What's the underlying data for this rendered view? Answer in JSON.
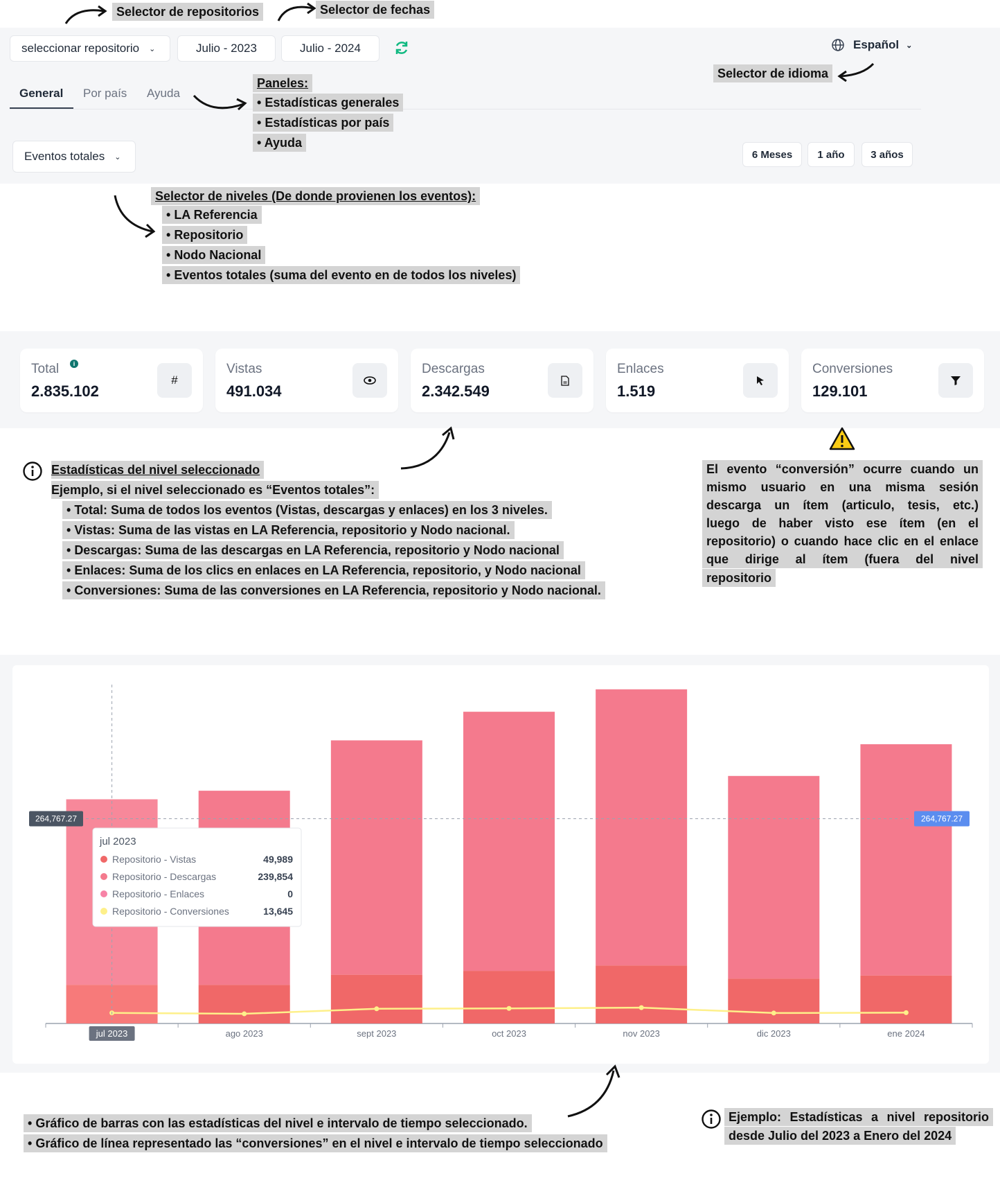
{
  "annotations": {
    "repo_selector": "Selector de repositorios",
    "date_selector": "Selector de fechas",
    "language_selector": "Selector de idioma",
    "panels_title": "Paneles:",
    "panels_items": [
      "Estadísticas generales",
      "Estadísticas por país",
      "Ayuda"
    ],
    "levels_title": "Selector de niveles (De donde provienen los eventos):",
    "levels_items": [
      "LA Referencia",
      "Repositorio",
      "Nodo Nacional",
      "Eventos totales (suma del evento en de todos los niveles)"
    ],
    "stats_title": "Estadísticas del nivel seleccionado",
    "stats_example": "Ejemplo, si el nivel seleccionado es “Eventos totales”:",
    "stats_items": [
      "Total: Suma de todos los eventos (Vistas, descargas y enlaces) en los 3 niveles.",
      "Vistas: Suma de las vistas en LA Referencia, repositorio y Nodo nacional.",
      "Descargas: Suma de las descargas en LA Referencia, repositorio y Nodo nacional",
      "Enlaces: Suma de los clics en enlaces en LA Referencia, repositorio, y Nodo nacional",
      "Conversiones: Suma de las conversiones en LA Referencia, repositorio y Nodo nacional."
    ],
    "conversion_note": [
      "El evento “conversión” ocurre cuando un",
      "mismo usuario en una misma sesión",
      "descarga un ítem (articulo, tesis, etc.)",
      "luego de haber visto ese ítem (en el",
      "repositorio) o cuando hace clic en el enlace",
      "que dirige al ítem (fuera del nivel",
      "repositorio"
    ],
    "chart_items": [
      "Gráfico de barras con las estadísticas del nivel e intervalo de tiempo seleccionado.",
      "Gráfico de línea representado las “conversiones” en el nivel e intervalo de tiempo seleccionado"
    ],
    "example_note": [
      "Ejemplo: Estadísticas a nivel repositorio",
      "desde Julio del 2023 a Enero del 2024"
    ]
  },
  "toolbar": {
    "repo_select": "seleccionar repositorio",
    "date_from": "Julio - 2023",
    "date_to": "Julio - 2024",
    "language": "Español"
  },
  "tabs": [
    "General",
    "Por país",
    "Ayuda"
  ],
  "level_select": "Eventos totales",
  "ranges": [
    "6 Meses",
    "1 año",
    "3 años"
  ],
  "stats": [
    {
      "label": "Total",
      "value": "2.835.102",
      "icon": "#"
    },
    {
      "label": "Vistas",
      "value": "491.034",
      "icon": "eye"
    },
    {
      "label": "Descargas",
      "value": "2.342.549",
      "icon": "file"
    },
    {
      "label": "Enlaces",
      "value": "1.519",
      "icon": "pointer"
    },
    {
      "label": "Conversiones",
      "value": "129.101",
      "icon": "funnel"
    }
  ],
  "colors": {
    "downloads": "#f47a8d",
    "views": "#f06868",
    "links": "#f783a6",
    "conversions": "#fef08a",
    "accent": "#10b981"
  },
  "chart_data": {
    "type": "bar",
    "categories": [
      "jul 2023",
      "ago 2023",
      "sept 2023",
      "oct 2023",
      "nov 2023",
      "dic 2023",
      "ene 2024"
    ],
    "series": [
      {
        "name": "Repositorio - Vistas",
        "values": [
          49989,
          49900,
          63000,
          68000,
          75000,
          58000,
          62000
        ]
      },
      {
        "name": "Repositorio - Descargas",
        "values": [
          239854,
          251000,
          303000,
          335000,
          357000,
          262000,
          299000
        ]
      },
      {
        "name": "Repositorio - Enlaces",
        "values": [
          0,
          0,
          0,
          0,
          0,
          0,
          0
        ]
      },
      {
        "name": "Repositorio - Conversiones",
        "values": [
          13645,
          12500,
          19000,
          19500,
          20500,
          13500,
          14000
        ]
      }
    ],
    "crosshair_value": "264,767.27",
    "ylim": [
      0,
      430000
    ],
    "tooltip": {
      "title": "jul 2023",
      "rows": [
        {
          "name": "Repositorio - Vistas",
          "value": "49,989"
        },
        {
          "name": "Repositorio - Descargas",
          "value": "239,854"
        },
        {
          "name": "Repositorio - Enlaces",
          "value": "0"
        },
        {
          "name": "Repositorio - Conversiones",
          "value": "13,645"
        }
      ]
    }
  }
}
